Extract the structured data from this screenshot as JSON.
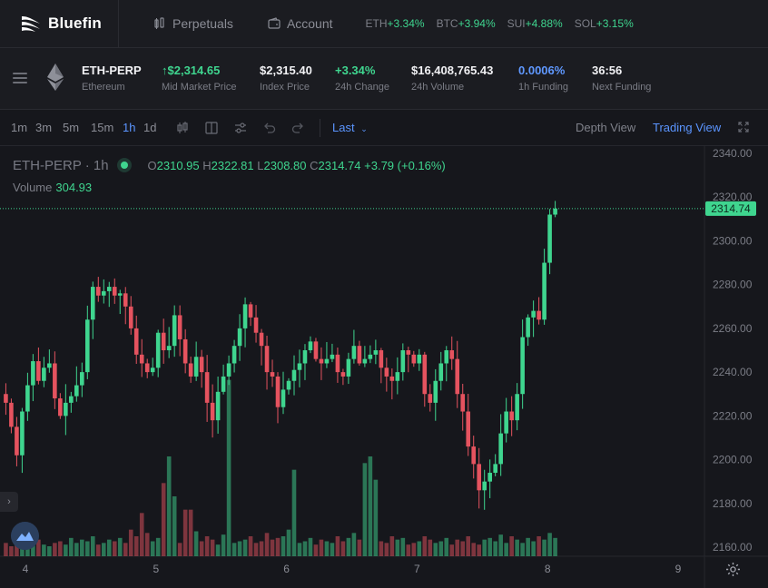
{
  "brand": {
    "name": "Bluefin"
  },
  "nav": {
    "links": [
      {
        "label": "Perpetuals",
        "icon": "perpetuals-icon"
      },
      {
        "label": "Account",
        "icon": "wallet-icon"
      }
    ],
    "ticker": [
      {
        "symbol": "ETH",
        "change": "+3.34%"
      },
      {
        "symbol": "BTC",
        "change": "+3.94%"
      },
      {
        "symbol": "SUI",
        "change": "+4.88%"
      },
      {
        "symbol": "SOL",
        "change": "+3.15%"
      }
    ]
  },
  "market": {
    "symbol": "ETH-PERP",
    "name": "Ethereum",
    "mid_price": "$2,314.65",
    "mid_price_label": "Mid Market Price",
    "index_price": "$2,315.40",
    "index_price_label": "Index Price",
    "change_24h": "+3.34%",
    "change_24h_label": "24h Change",
    "volume_24h": "$16,408,765.43",
    "volume_24h_label": "24h Volume",
    "funding_1h": "0.0006%",
    "funding_1h_label": "1h Funding",
    "next_funding": "36:56",
    "next_funding_label": "Next Funding"
  },
  "toolbar": {
    "timeframes": [
      "1m",
      "3m",
      "5m",
      "15m",
      "1h",
      "1d"
    ],
    "active_timeframe": "1h",
    "price_source": "Last",
    "depth_view": "Depth View",
    "trading_view": "Trading View"
  },
  "legend": {
    "pair": "ETH-PERP",
    "interval": "1h",
    "o_key": "O",
    "o": "2310.95",
    "h_key": "H",
    "h": "2322.81",
    "l_key": "L",
    "l": "2308.80",
    "c_key": "C",
    "c": "2314.74",
    "change": "+3.79 (+0.16%)",
    "volume_label": "Volume",
    "volume": "304.93"
  },
  "colors": {
    "up": "#3fd58f",
    "down": "#e5535f",
    "accent": "#5b95ff"
  },
  "chart_data": {
    "type": "candlestick",
    "y_ticks": [
      "2340.00",
      "2320.00",
      "2300.00",
      "2280.00",
      "2260.00",
      "2240.00",
      "2220.00",
      "2200.00",
      "2180.00",
      "2160.00"
    ],
    "ylim": [
      2155,
      2342
    ],
    "x_ticks": [
      {
        "label": "4",
        "day": 4
      },
      {
        "label": "5",
        "day": 5
      },
      {
        "label": "6",
        "day": 6
      },
      {
        "label": "7",
        "day": 7
      },
      {
        "label": "8",
        "day": 8
      },
      {
        "label": "9",
        "day": 9
      }
    ],
    "last_price": "2314.74",
    "last_value": 2314.74,
    "candles_start_day": 3.85,
    "candle_hours": 1,
    "closes": [
      2226,
      2215,
      2202,
      2222,
      2234,
      2245,
      2236,
      2242,
      2244,
      2228,
      2220,
      2226,
      2229,
      2234,
      2240,
      2264,
      2279,
      2275,
      2277,
      2279,
      2275,
      2276,
      2270,
      2260,
      2248,
      2244,
      2240,
      2242,
      2258,
      2250,
      2252,
      2266,
      2255,
      2244,
      2238,
      2247,
      2240,
      2226,
      2218,
      2231,
      2238,
      2244,
      2252,
      2260,
      2271,
      2265,
      2258,
      2252,
      2240,
      2238,
      2224,
      2232,
      2236,
      2241,
      2244,
      2250,
      2254,
      2246,
      2244,
      2246,
      2248,
      2240,
      2238,
      2246,
      2252,
      2244,
      2246,
      2248,
      2250,
      2242,
      2238,
      2236,
      2240,
      2250,
      2248,
      2244,
      2248,
      2230,
      2226,
      2236,
      2244,
      2250,
      2246,
      2230,
      2222,
      2206,
      2198,
      2186,
      2190,
      2194,
      2198,
      2212,
      2222,
      2218,
      2230,
      2256,
      2265,
      2268,
      2264,
      2290,
      2312,
      2314.74
    ],
    "volumes": [
      8,
      6,
      7,
      9,
      6,
      8,
      10,
      7,
      6,
      8,
      9,
      7,
      11,
      8,
      10,
      9,
      12,
      7,
      8,
      10,
      9,
      11,
      8,
      16,
      12,
      26,
      14,
      9,
      11,
      10,
      13,
      12,
      8,
      28,
      11,
      15,
      9,
      12,
      10,
      7,
      13,
      11,
      8,
      9,
      10,
      12,
      8,
      9,
      14,
      10,
      11,
      12,
      16,
      10,
      8,
      9,
      11,
      7,
      10,
      9,
      8,
      12,
      9,
      11,
      14,
      10,
      22,
      27,
      18,
      9,
      8,
      12,
      10,
      11,
      7,
      8,
      9,
      12,
      10,
      8,
      9,
      11,
      7,
      10,
      9,
      12,
      8,
      7,
      10,
      11,
      9,
      13,
      8,
      12,
      10,
      8,
      11,
      9,
      12,
      10,
      14,
      11
    ],
    "vol_max": 60,
    "volume_spikes": [
      [
        29,
        22
      ],
      [
        30,
        30
      ],
      [
        31,
        18
      ],
      [
        34,
        14
      ],
      [
        41,
        53
      ],
      [
        53,
        26
      ],
      [
        66,
        28
      ],
      [
        67,
        30
      ],
      [
        68,
        23
      ]
    ]
  }
}
